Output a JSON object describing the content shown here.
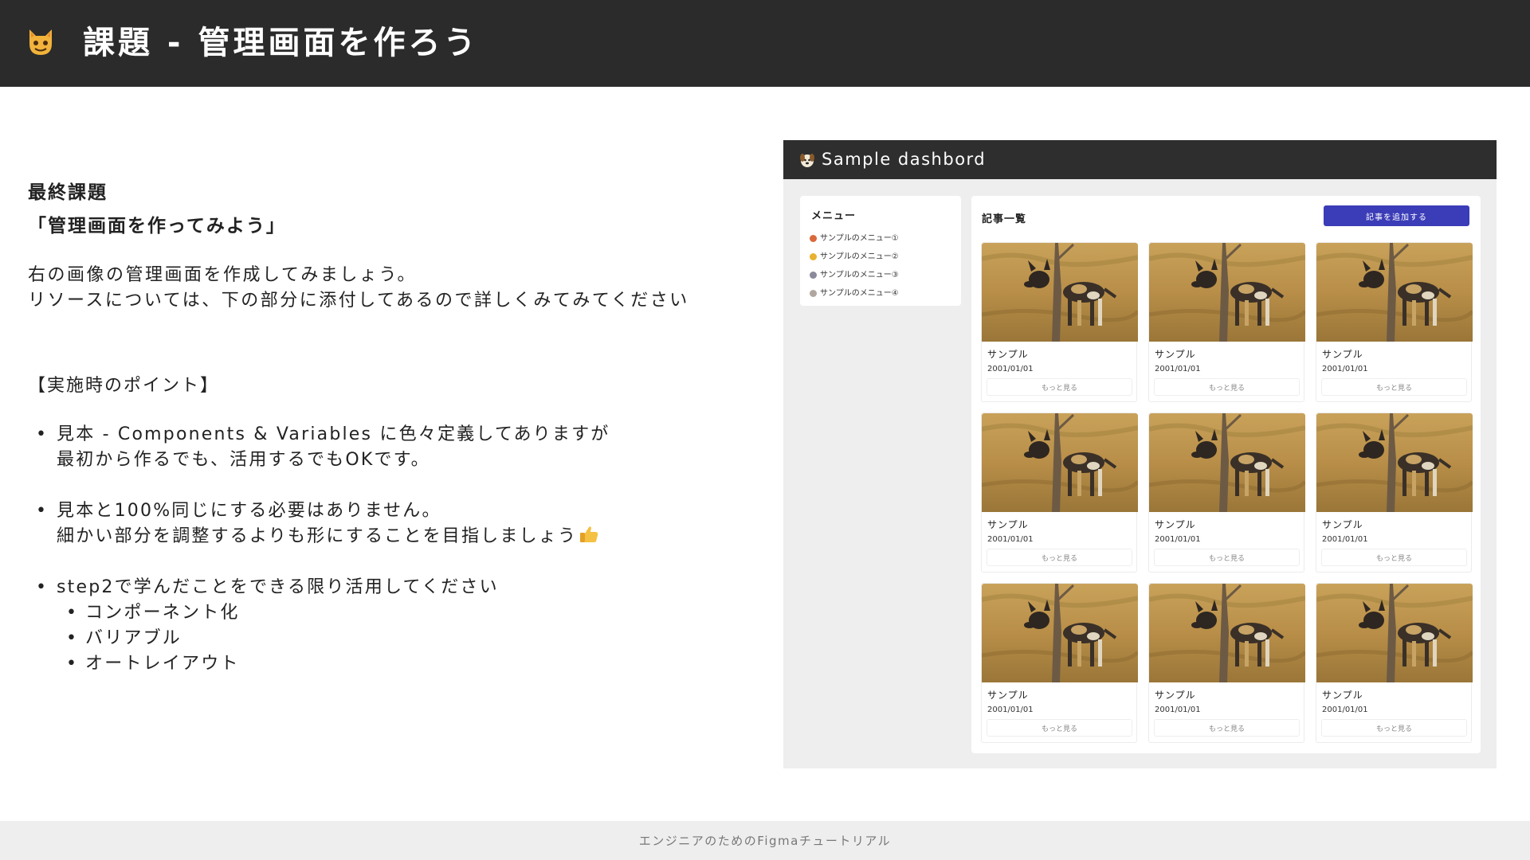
{
  "header": {
    "emoji": "cat-face-icon",
    "title": "課題 - 管理画面を作ろう"
  },
  "left": {
    "final_label": "最終課題",
    "final_title": "「管理画面を作ってみよう」",
    "intro_lines": [
      "右の画像の管理画面を作成してみましょう。",
      "リソースについては、下の部分に添付してあるので詳しくみてみてください"
    ],
    "points_title": "【実施時のポイント】",
    "bullets": [
      {
        "lines": [
          "見本 - Components & Variables に色々定義してありますが",
          "最初から作るでも、活用するでもOKです。"
        ]
      },
      {
        "lines": [
          "見本と100%同じにする必要はありません。",
          "細かい部分を調整するよりも形にすることを目指しましょう"
        ],
        "trailing_icon": "thumbs-up-icon"
      },
      {
        "lines": [
          "step2で学んだことをできる限り活用してください"
        ],
        "sub_bullets": [
          "コンポーネント化",
          "バリアブル",
          "オートレイアウト"
        ]
      }
    ]
  },
  "dashboard": {
    "title": "Sample dashbord",
    "title_icon": "dog-face-icon",
    "menu": {
      "title": "メニュー",
      "items": [
        {
          "label": "サンプルのメニュー①",
          "icon": "fox-icon",
          "color": "#d9693a"
        },
        {
          "label": "サンプルのメニュー②",
          "icon": "smile-cat-icon",
          "color": "#e8b230"
        },
        {
          "label": "サンプルのメニュー③",
          "icon": "wolf-icon",
          "color": "#8a8a9a"
        },
        {
          "label": "サンプルのメニュー④",
          "icon": "rabbit-icon",
          "color": "#b0a7a0"
        }
      ]
    },
    "content": {
      "title": "記事一覧",
      "add_button": "記事を追加する",
      "cards": [
        {
          "title": "サンプル",
          "date": "2001/01/01",
          "more": "もっと見る"
        },
        {
          "title": "サンプル",
          "date": "2001/01/01",
          "more": "もっと見る"
        },
        {
          "title": "サンプル",
          "date": "2001/01/01",
          "more": "もっと見る"
        },
        {
          "title": "サンプル",
          "date": "2001/01/01",
          "more": "もっと見る"
        },
        {
          "title": "サンプル",
          "date": "2001/01/01",
          "more": "もっと見る"
        },
        {
          "title": "サンプル",
          "date": "2001/01/01",
          "more": "もっと見る"
        },
        {
          "title": "サンプル",
          "date": "2001/01/01",
          "more": "もっと見る"
        },
        {
          "title": "サンプル",
          "date": "2001/01/01",
          "more": "もっと見る"
        },
        {
          "title": "サンプル",
          "date": "2001/01/01",
          "more": "もっと見る"
        }
      ],
      "card_image": "wild-dog-photo"
    }
  },
  "footer": {
    "text": "エンジニアのためのFigmaチュートリアル"
  },
  "colors": {
    "header_bg": "#2b2b2b",
    "button_accent": "#3b3cb7",
    "footer_bg": "#eeeeee"
  }
}
